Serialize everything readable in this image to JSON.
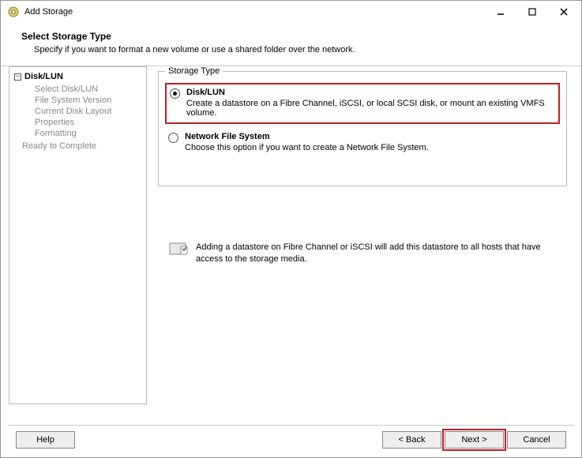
{
  "window": {
    "title": "Add Storage"
  },
  "header": {
    "title": "Select Storage Type",
    "desc": "Specify if you want to format a new volume or use a shared folder over the network."
  },
  "nav": {
    "root": "Disk/LUN",
    "children": [
      "Select Disk/LUN",
      "File System Version",
      "Current Disk Layout",
      "Properties",
      "Formatting"
    ],
    "bottom": "Ready to Complete"
  },
  "storage_type": {
    "legend": "Storage Type",
    "options": [
      {
        "title": "Disk/LUN",
        "desc": "Create a datastore on a Fibre Channel, iSCSI, or local SCSI disk, or mount an existing VMFS volume.",
        "selected": true,
        "highlighted": true
      },
      {
        "title": "Network File System",
        "desc": "Choose this option if you want to create a Network File System.",
        "selected": false,
        "highlighted": false
      }
    ],
    "info": "Adding a datastore on Fibre Channel or iSCSI will add this datastore to all hosts that have access to the storage media."
  },
  "buttons": {
    "help": "Help",
    "back": "< Back",
    "next": "Next >",
    "cancel": "Cancel"
  }
}
